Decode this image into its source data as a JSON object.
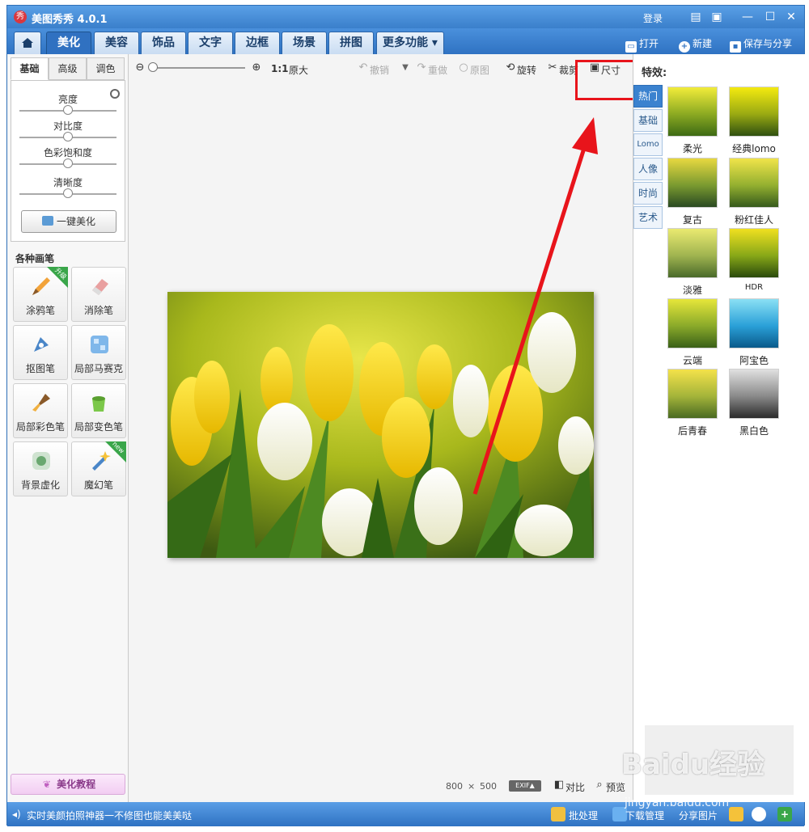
{
  "window": {
    "title": "美图秀秀 4.0.1",
    "login": "登录",
    "controls": [
      "▤",
      "▣",
      "—",
      "☐",
      "✕"
    ]
  },
  "nav": {
    "tabs": [
      "美化",
      "美容",
      "饰品",
      "文字",
      "边框",
      "场景",
      "拼图",
      "更多功能 ▾"
    ],
    "open": "打开",
    "new": "新建",
    "save_share": "保存与分享"
  },
  "left": {
    "subtabs": [
      "基础",
      "高级",
      "调色"
    ],
    "sliders": [
      "亮度",
      "对比度",
      "色彩饱和度",
      "清晰度"
    ],
    "one_click": "一键美化",
    "brush_title": "各种画笔",
    "brushes": [
      {
        "label": "涂鸦笔",
        "badge": "升级"
      },
      {
        "label": "消除笔",
        "badge": ""
      },
      {
        "label": "抠图笔",
        "badge": ""
      },
      {
        "label": "局部马赛克",
        "badge": ""
      },
      {
        "label": "局部彩色笔",
        "badge": ""
      },
      {
        "label": "局部变色笔",
        "badge": ""
      },
      {
        "label": "背景虚化",
        "badge": ""
      },
      {
        "label": "魔幻笔",
        "badge": "new"
      }
    ],
    "tutorial": "美化教程"
  },
  "toolbar": {
    "ratio": "1:1",
    "original_size": "原大",
    "undo": "撤销",
    "redo": "重做",
    "original": "原图",
    "rotate": "旋转",
    "crop": "裁剪",
    "size": "尺寸"
  },
  "canvas": {
    "width": "800",
    "times": "×",
    "height": "500",
    "exif": "EXIF▲",
    "compare": "对比",
    "preview": "预览"
  },
  "effects": {
    "title": "特效:",
    "tabs": [
      "热门",
      "基础",
      "Lomo",
      "人像",
      "时尚",
      "艺术"
    ],
    "items": [
      "柔光",
      "经典lomo",
      "复古",
      "粉红佳人",
      "淡雅",
      "HDR",
      "云端",
      "阿宝色",
      "后青春",
      "黑白色"
    ]
  },
  "status": {
    "tip": "实时美颜拍照神器一不修图也能美美哒",
    "batch": "批处理",
    "download": "下载管理",
    "share": "分享图片"
  },
  "watermark": {
    "brand": "Baidu经验",
    "url": "jingyan.baidu.com"
  },
  "colors": {
    "accent": "#3b82cf",
    "highlight": "#e8141b",
    "badge_green": "#3aa64a"
  }
}
